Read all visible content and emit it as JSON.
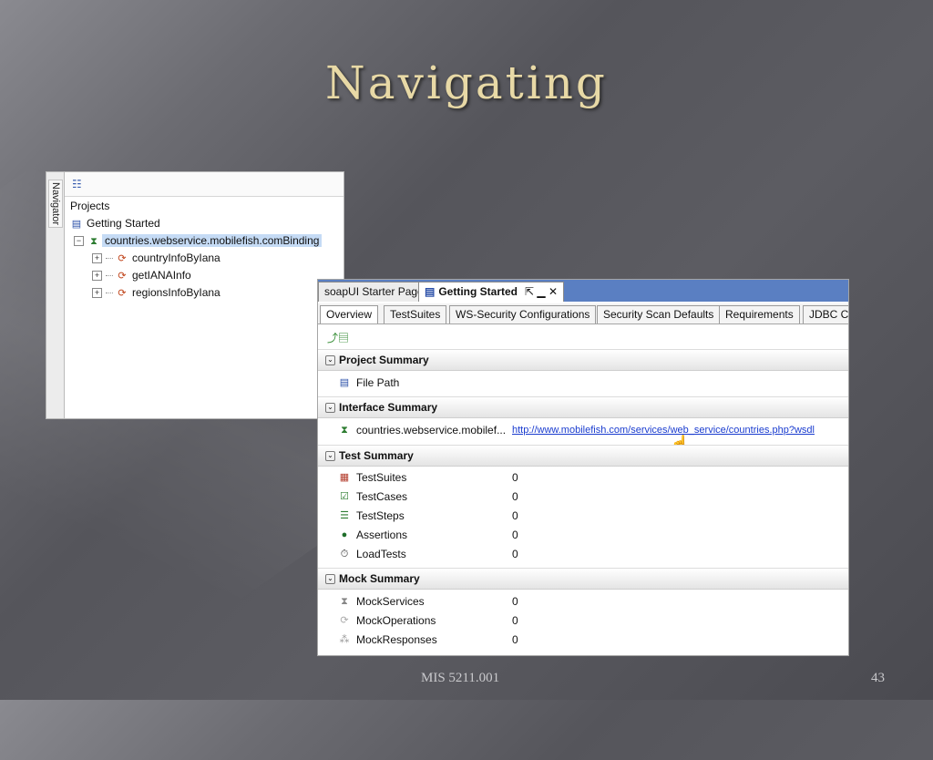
{
  "slide": {
    "title": "Navigating",
    "footer": "MIS 5211.001",
    "page_number": "43"
  },
  "navigator": {
    "tab_label": "Navigator",
    "toolbar_icon": "tree-view-icon",
    "tree": {
      "root": "Projects",
      "project": "Getting Started",
      "binding": "countries.webservice.mobilefish.comBinding",
      "operations": [
        "countryInfoByIana",
        "getIANAInfo",
        "regionsInfoByIana"
      ]
    }
  },
  "editor": {
    "doc_tabs": [
      {
        "label": "soapUI Starter Page",
        "active": false
      },
      {
        "label": "Getting Started",
        "active": true
      }
    ],
    "tab_controls": "⇱ ▁ ✕",
    "sub_tabs": [
      {
        "label": "Overview",
        "active": true
      },
      {
        "label": "TestSuites"
      },
      {
        "label": "WS-Security Configurations"
      },
      {
        "label": "Security Scan Defaults"
      },
      {
        "label": "Requirements"
      },
      {
        "label": "JDBC Co"
      }
    ],
    "sections": {
      "project_summary": {
        "title": "Project Summary",
        "rows": [
          {
            "label": "File Path",
            "value": ""
          }
        ]
      },
      "interface_summary": {
        "title": "Interface Summary",
        "rows": [
          {
            "label": "countries.webservice.mobilef...",
            "value": "http://www.mobilefish.com/services/web_service/countries.php?wsdl"
          }
        ]
      },
      "test_summary": {
        "title": "Test Summary",
        "rows": [
          {
            "label": "TestSuites",
            "value": "0"
          },
          {
            "label": "TestCases",
            "value": "0"
          },
          {
            "label": "TestSteps",
            "value": "0"
          },
          {
            "label": "Assertions",
            "value": "0"
          },
          {
            "label": "LoadTests",
            "value": "0"
          }
        ]
      },
      "mock_summary": {
        "title": "Mock Summary",
        "rows": [
          {
            "label": "MockServices",
            "value": "0"
          },
          {
            "label": "MockOperations",
            "value": "0"
          },
          {
            "label": "MockResponses",
            "value": "0"
          }
        ]
      }
    }
  }
}
